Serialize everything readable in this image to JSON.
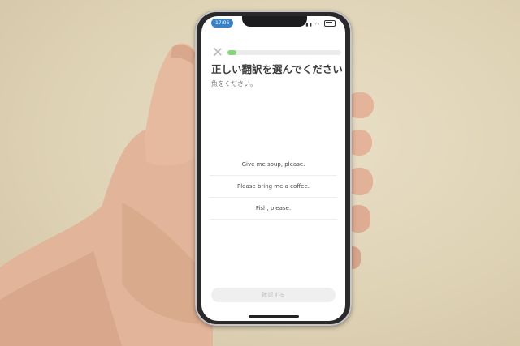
{
  "status_bar": {
    "time": "17:06",
    "icons": [
      "signal-icon",
      "wifi-icon",
      "battery-icon"
    ]
  },
  "lesson": {
    "progress": 0.08,
    "prompt_title": "正しい翻訳を選んでください",
    "sentence": "魚をください。",
    "choices": [
      "Give me soup, please.",
      "Please bring me a coffee.",
      "Fish, please."
    ],
    "check_button_label": "確認する"
  },
  "colors": {
    "progress_fill": "#86d67a",
    "time_pill": "#3b82c4"
  }
}
